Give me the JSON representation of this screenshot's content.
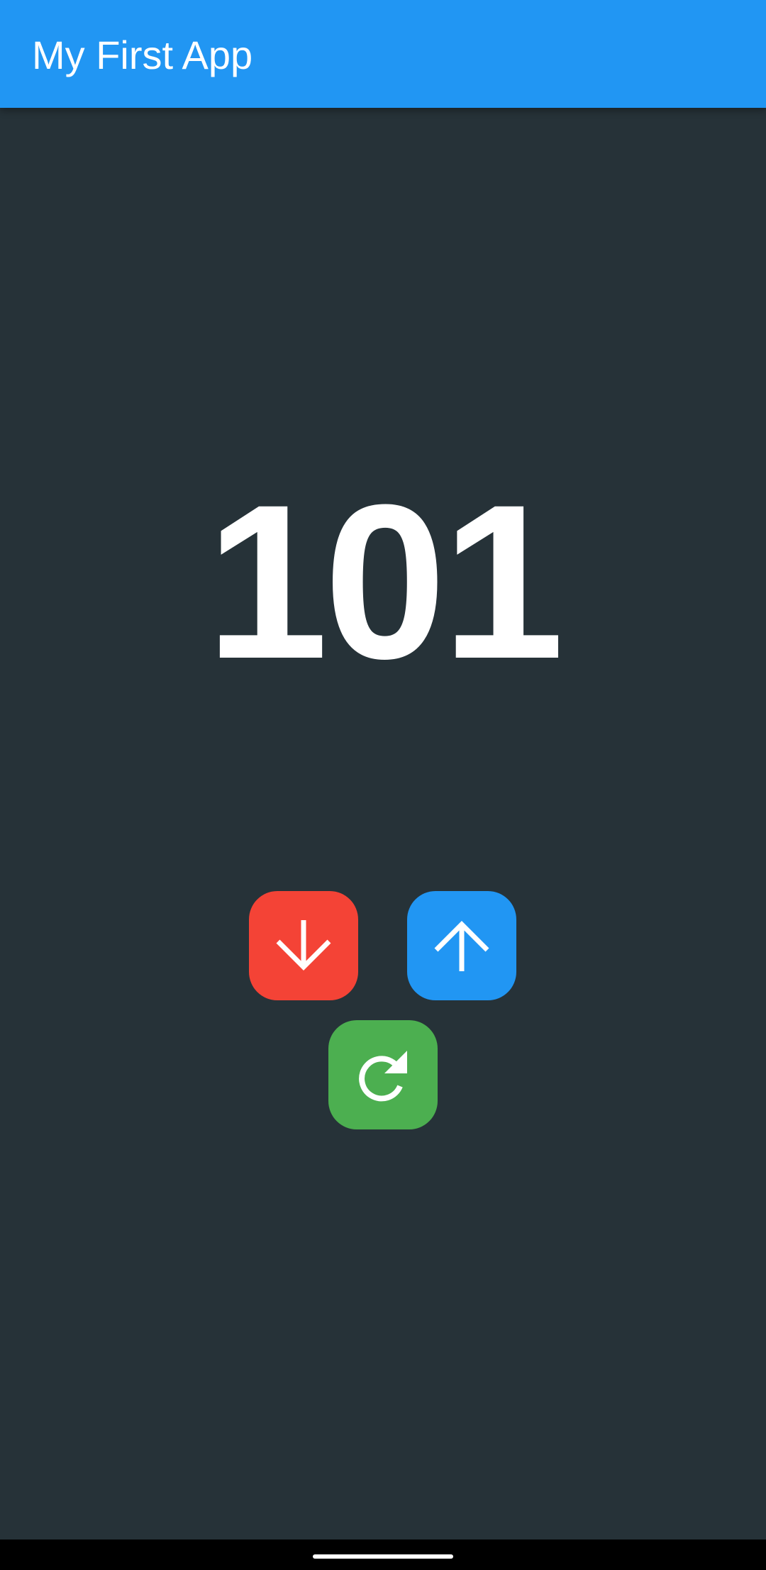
{
  "app_bar": {
    "title": "My First App",
    "color": "#2196F3"
  },
  "counter": {
    "value": "101"
  },
  "buttons": {
    "decrement": {
      "icon": "arrow-down-icon",
      "color": "#F44336"
    },
    "increment": {
      "icon": "arrow-up-icon",
      "color": "#2196F3"
    },
    "reset": {
      "icon": "refresh-icon",
      "color": "#4CAF50"
    }
  },
  "colors": {
    "background": "#263238",
    "text": "#FFFFFF"
  }
}
